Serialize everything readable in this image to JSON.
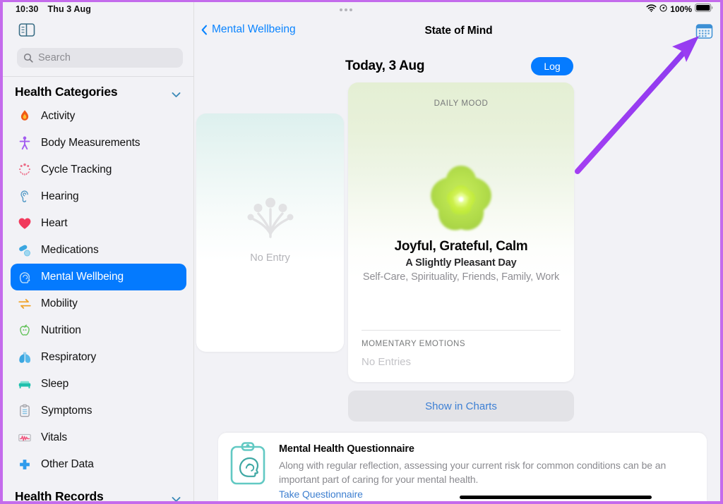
{
  "status_bar": {
    "time": "10:30",
    "date": "Thu 3 Aug",
    "wifi_icon": "wifi-icon",
    "location_icon": "location-arrow-icon",
    "battery_percent": "100%",
    "battery_icon": "battery-full-icon"
  },
  "sidebar": {
    "toggle_icon": "sidebar-toggle-icon",
    "search": {
      "placeholder": "Search",
      "icon": "search-icon",
      "value": ""
    },
    "sections": [
      {
        "label": "Health Categories",
        "chevron": "chevron-down-icon",
        "expanded": true
      },
      {
        "label": "Health Records",
        "chevron": "chevron-down-icon",
        "expanded": false
      }
    ],
    "items": [
      {
        "label": "Activity",
        "icon": "flame-icon",
        "selected": false
      },
      {
        "label": "Body Measurements",
        "icon": "body-icon",
        "selected": false
      },
      {
        "label": "Cycle Tracking",
        "icon": "cycle-icon",
        "selected": false
      },
      {
        "label": "Hearing",
        "icon": "ear-icon",
        "selected": false
      },
      {
        "label": "Heart",
        "icon": "heart-icon",
        "selected": false
      },
      {
        "label": "Medications",
        "icon": "pills-icon",
        "selected": false
      },
      {
        "label": "Mental Wellbeing",
        "icon": "brain-head-icon",
        "selected": true
      },
      {
        "label": "Mobility",
        "icon": "arrows-icon",
        "selected": false
      },
      {
        "label": "Nutrition",
        "icon": "apple-icon",
        "selected": false
      },
      {
        "label": "Respiratory",
        "icon": "lungs-icon",
        "selected": false
      },
      {
        "label": "Sleep",
        "icon": "bed-icon",
        "selected": false
      },
      {
        "label": "Symptoms",
        "icon": "clipboard-icon",
        "selected": false
      },
      {
        "label": "Vitals",
        "icon": "waveform-icon",
        "selected": false
      },
      {
        "label": "Other Data",
        "icon": "cross-icon",
        "selected": false
      }
    ]
  },
  "navbar": {
    "back_label": "Mental Wellbeing",
    "back_icon": "chevron-left-icon",
    "title": "State of Mind",
    "calendar_icon": "calendar-icon"
  },
  "main": {
    "date_heading": "Today, 3 Aug",
    "log_button": "Log",
    "no_entry_card": {
      "icon": "flower-sprout-icon",
      "label": "No Entry"
    },
    "mood_card": {
      "section_label": "DAILY MOOD",
      "shape_icon": "mood-flower-icon",
      "title": "Joyful, Grateful, Calm",
      "subtitle": "A Slightly Pleasant Day",
      "tags": "Self-Care, Spirituality, Friends, Family, Work",
      "momentary_label": "MOMENTARY EMOTIONS",
      "momentary_value": "No Entries"
    },
    "show_in_charts": "Show in Charts",
    "questionnaire": {
      "icon": "mental-health-clipboard-icon",
      "title": "Mental Health Questionnaire",
      "description": "Along with regular reflection, assessing your current risk for common conditions can be an important part of caring for your mental health.",
      "link": "Take Questionnaire"
    }
  },
  "annotation": {
    "arrow_icon": "pointer-arrow-icon",
    "arrow_color": "#9a3ff0",
    "border_color": "#c46bec"
  },
  "colors": {
    "accent_blue": "#047afe",
    "link_blue": "#0a84ff",
    "background": "#f2f2f6",
    "card_white": "#ffffff",
    "mood_green": "#a5d93a",
    "teal": "#4cc6bd"
  }
}
